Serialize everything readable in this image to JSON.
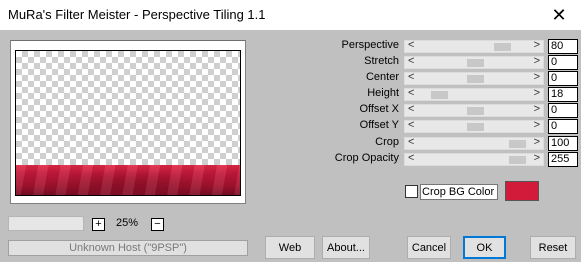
{
  "window": {
    "title": "MuRa's Filter Meister - Perspective Tiling 1.1",
    "close_glyph": "✕"
  },
  "preview": {
    "zoom_minus": "−",
    "zoom_plus": "+",
    "zoom_value": "25%",
    "band_color": "#c2183a"
  },
  "status": {
    "text": "Unknown Host (\"9PSP\")"
  },
  "params": [
    {
      "label": "Perspective",
      "value": "80",
      "fraction": 0.78
    },
    {
      "label": "Stretch",
      "value": "0",
      "fraction": 0.5
    },
    {
      "label": "Center",
      "value": "0",
      "fraction": 0.5
    },
    {
      "label": "Height",
      "value": "18",
      "fraction": 0.14
    },
    {
      "label": "Offset X",
      "value": "0",
      "fraction": 0.5
    },
    {
      "label": "Offset Y",
      "value": "0",
      "fraction": 0.5
    },
    {
      "label": "Crop",
      "value": "100",
      "fraction": 0.93
    },
    {
      "label": "Crop Opacity",
      "value": "255",
      "fraction": 0.93
    }
  ],
  "slider_arrows": {
    "left": "<",
    "right": ">"
  },
  "crop_bg": {
    "label": "Crop BG Color",
    "checked": false,
    "color": "#d21a3a"
  },
  "buttons": {
    "web": "Web",
    "about": "About...",
    "cancel": "Cancel",
    "ok": "OK",
    "reset": "Reset"
  }
}
